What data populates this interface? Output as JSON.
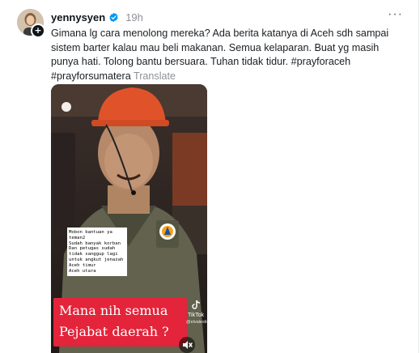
{
  "post": {
    "username": "yennysyen",
    "timestamp": "19h",
    "more_label": "···",
    "body": "Gimana lg cara menolong mereka? Ada berita katanya di Aceh sdh sampai sistem barter kalau mau beli makanan. Semua kelaparan. Buat yg masih punya hati. Tolong bantu bersuara. Tuhan tidak tidur. #prayforaceh #prayforsumatera",
    "translate_label": "Translate"
  },
  "video": {
    "overlay_note": "Mobon bantuan ya teman2\nSudah banyak korban\nDan petugas sudah tidak sanggup lagi untuk angkut jenazah\nAceh timur\nAceh utara",
    "caption_line1": "Mana nih semua",
    "caption_line2": "Pejabat daerah ?",
    "watermark_brand": "TikTok",
    "watermark_user": "@elvalestic68"
  },
  "icons": {
    "verified": "verified-badge-icon",
    "follow": "plus-icon",
    "mute": "speaker-muted-icon",
    "tiktok": "tiktok-logo-icon"
  },
  "colors": {
    "verified": "#0095f6",
    "caption_bg": "#e3243a",
    "helmet": "#e0532a",
    "muted_text": "#8e9196"
  }
}
